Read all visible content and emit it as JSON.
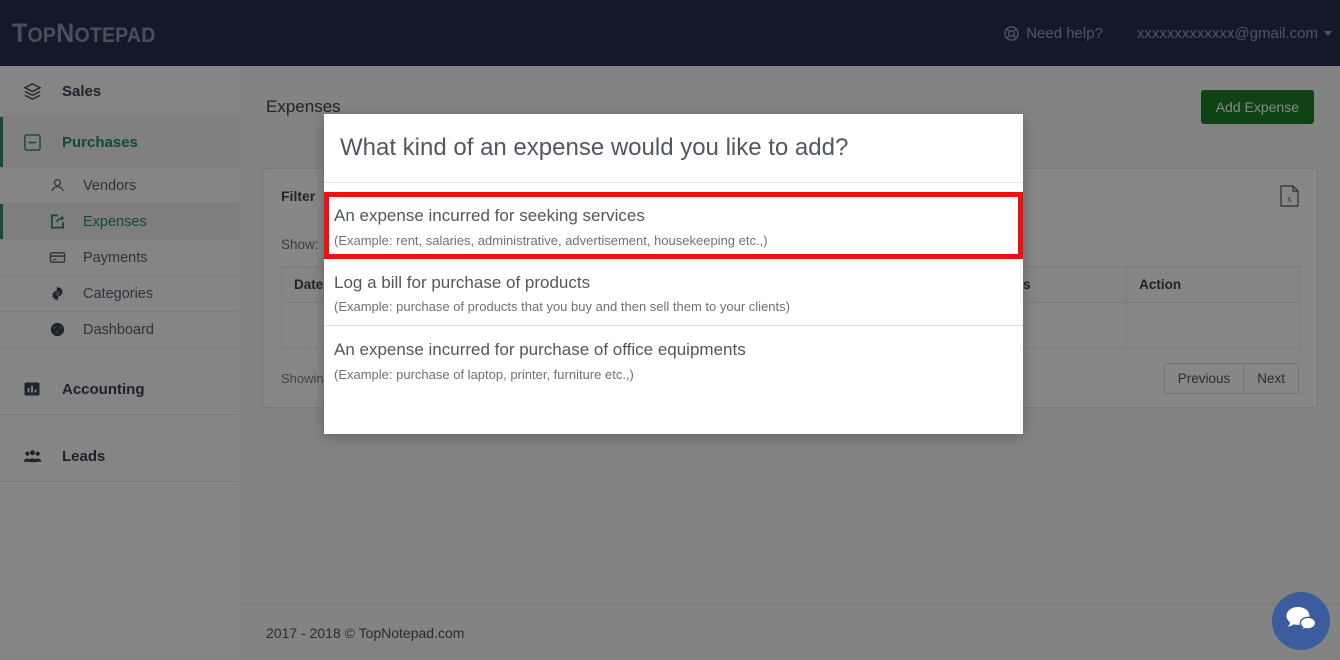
{
  "header": {
    "logo_top": "Top",
    "logo_note": "Notepad",
    "logo_full": "TopNotepad",
    "need_help": "Need help?",
    "account_email": "xxxxxxxxxxxxx@gmail.com",
    "help_icon": "lifebuoy-icon",
    "caret_icon": "chevron-down-icon",
    "bg_color": "#27304f"
  },
  "sidebar": {
    "items": [
      {
        "label": "Sales",
        "icon": "layers-icon",
        "level": "top",
        "active": false
      },
      {
        "label": "Purchases",
        "icon": "minus-square-icon",
        "level": "top",
        "active": true
      },
      {
        "label": "Vendors",
        "icon": "user-icon",
        "level": "sub",
        "active": false
      },
      {
        "label": "Expenses",
        "icon": "share-export-icon",
        "level": "sub",
        "active": true
      },
      {
        "label": "Payments",
        "icon": "credit-card-icon",
        "level": "sub",
        "active": false
      },
      {
        "label": "Categories",
        "icon": "gear-icon",
        "level": "sub",
        "active": false
      },
      {
        "label": "Dashboard",
        "icon": "gauge-icon",
        "level": "sub",
        "active": false
      },
      {
        "label": "Accounting",
        "icon": "bar-chart-icon",
        "level": "top",
        "active": false
      },
      {
        "label": "Leads",
        "icon": "users-group-icon",
        "level": "top",
        "active": false
      }
    ],
    "accent_color": "#2a8a5e"
  },
  "main": {
    "page_title": "Expenses",
    "add_button": "Add Expense",
    "add_button_color": "#1d7d28",
    "filter_label": "Filter",
    "export_icon": "excel-export-icon",
    "show_label": "Show:",
    "show_value": "",
    "table": {
      "columns": [
        "Date",
        "Status",
        "Action"
      ],
      "rows": []
    },
    "showing_text": "Showing",
    "pagination": {
      "previous": "Previous",
      "next": "Next"
    },
    "footer_text": "2017 - 2018 © TopNotepad.com"
  },
  "modal": {
    "title": "What kind of an expense would you like to add?",
    "highlight_color": "#ee1111",
    "options": [
      {
        "title": "An expense incurred for seeking services",
        "subtitle": "(Example: rent, salaries, administrative, advertisement, housekeeping etc.,)",
        "highlighted": true
      },
      {
        "title": "Log a bill for purchase of products",
        "subtitle": "(Example: purchase of products that you buy and then sell them to your clients)",
        "highlighted": false
      },
      {
        "title": "An expense incurred for purchase of office equipments",
        "subtitle": "(Example: purchase of laptop, printer, furniture etc.,)",
        "highlighted": false
      }
    ]
  },
  "chat_widget": {
    "icon": "chat-bubbles-icon",
    "color": "#3b5d9e"
  }
}
